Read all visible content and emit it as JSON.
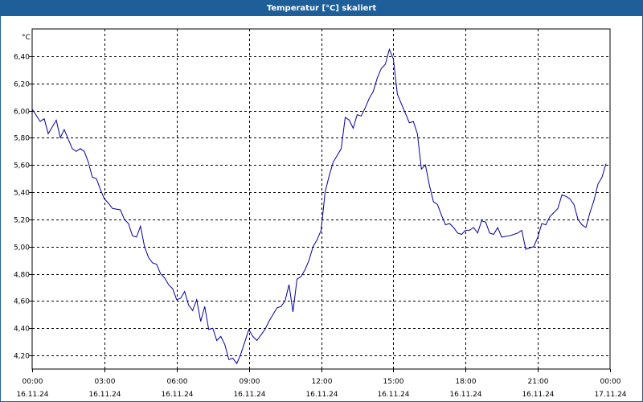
{
  "window": {
    "title": "Temperatur [°C] skaliert"
  },
  "colors": {
    "titlebar": "#1f5f99",
    "series": "#0000a0",
    "grid": "#000000"
  },
  "chart_data": {
    "type": "line",
    "title": "Temperatur [°C] skaliert",
    "yunit": "°C",
    "ylim": [
      4.1,
      6.6
    ],
    "yticks": [
      4.2,
      4.4,
      4.6,
      4.8,
      5.0,
      5.2,
      5.4,
      5.6,
      5.8,
      6.0,
      6.2,
      6.4
    ],
    "ytick_labels": [
      "4,20",
      "4,40",
      "4,60",
      "4,80",
      "5,00",
      "5,20",
      "5,40",
      "5,60",
      "5,80",
      "6,00",
      "6,20",
      "6,40"
    ],
    "xlim": [
      "16.11.24 00:00",
      "17.11.24 00:00"
    ],
    "xticks": [
      {
        "time": "00:00",
        "date": "16.11.24"
      },
      {
        "time": "03:00",
        "date": "16.11.24"
      },
      {
        "time": "06:00",
        "date": "16.11.24"
      },
      {
        "time": "09:00",
        "date": "16.11.24"
      },
      {
        "time": "12:00",
        "date": "16.11.24"
      },
      {
        "time": "15:00",
        "date": "16.11.24"
      },
      {
        "time": "18:00",
        "date": "16.11.24"
      },
      {
        "time": "21:00",
        "date": "16.11.24"
      },
      {
        "time": "00:00",
        "date": "17.11.24"
      }
    ],
    "grid": true,
    "series": [
      {
        "points": [
          [
            "16.11.24 00:00",
            6.01
          ],
          [
            "16.11.24 00:20",
            5.92
          ],
          [
            "16.11.24 00:30",
            5.94
          ],
          [
            "16.11.24 00:40",
            5.83
          ],
          [
            "16.11.24 01:00",
            5.93
          ],
          [
            "16.11.24 01:10",
            5.8
          ],
          [
            "16.11.24 01:20",
            5.86
          ],
          [
            "16.11.24 01:40",
            5.72
          ],
          [
            "16.11.24 01:50",
            5.7
          ],
          [
            "16.11.24 02:00",
            5.72
          ],
          [
            "16.11.24 02:10",
            5.7
          ],
          [
            "16.11.24 02:20",
            5.62
          ],
          [
            "16.11.24 02:30",
            5.51
          ],
          [
            "16.11.24 02:40",
            5.5
          ],
          [
            "16.11.24 02:50",
            5.42
          ],
          [
            "16.11.24 03:00",
            5.35
          ],
          [
            "16.11.24 03:10",
            5.32
          ],
          [
            "16.11.24 03:20",
            5.28
          ],
          [
            "16.11.24 03:40",
            5.27
          ],
          [
            "16.11.24 03:50",
            5.2
          ],
          [
            "16.11.24 04:00",
            5.17
          ],
          [
            "16.11.24 04:10",
            5.08
          ],
          [
            "16.11.24 04:20",
            5.07
          ],
          [
            "16.11.24 04:30",
            5.15
          ],
          [
            "16.11.24 04:40",
            5.0
          ],
          [
            "16.11.24 04:50",
            4.92
          ],
          [
            "16.11.24 05:00",
            4.88
          ],
          [
            "16.11.24 05:10",
            4.87
          ],
          [
            "16.11.24 05:20",
            4.8
          ],
          [
            "16.11.24 05:30",
            4.77
          ],
          [
            "16.11.24 05:40",
            4.72
          ],
          [
            "16.11.24 05:50",
            4.69
          ],
          [
            "16.11.24 06:00",
            4.61
          ],
          [
            "16.11.24 06:10",
            4.62
          ],
          [
            "16.11.24 06:20",
            4.67
          ],
          [
            "16.11.24 06:30",
            4.57
          ],
          [
            "16.11.24 06:40",
            4.53
          ],
          [
            "16.11.24 06:50",
            4.61
          ],
          [
            "16.11.24 07:00",
            4.45
          ],
          [
            "16.11.24 07:10",
            4.56
          ],
          [
            "16.11.24 07:20",
            4.39
          ],
          [
            "16.11.24 07:30",
            4.4
          ],
          [
            "16.11.24 07:40",
            4.31
          ],
          [
            "16.11.24 07:50",
            4.34
          ],
          [
            "16.11.24 08:00",
            4.28
          ],
          [
            "16.11.24 08:10",
            4.17
          ],
          [
            "16.11.24 08:20",
            4.18
          ],
          [
            "16.11.24 08:30",
            4.14
          ],
          [
            "16.11.24 08:40",
            4.21
          ],
          [
            "16.11.24 08:50",
            4.3
          ],
          [
            "16.11.24 09:00",
            4.39
          ],
          [
            "16.11.24 09:10",
            4.34
          ],
          [
            "16.11.24 09:20",
            4.31
          ],
          [
            "16.11.24 09:30",
            4.35
          ],
          [
            "16.11.24 09:40",
            4.39
          ],
          [
            "16.11.24 09:50",
            4.45
          ],
          [
            "16.11.24 10:00",
            4.5
          ],
          [
            "16.11.24 10:10",
            4.55
          ],
          [
            "16.11.24 10:20",
            4.56
          ],
          [
            "16.11.24 10:30",
            4.6
          ],
          [
            "16.11.24 10:40",
            4.72
          ],
          [
            "16.11.24 10:50",
            4.52
          ],
          [
            "16.11.24 11:00",
            4.76
          ],
          [
            "16.11.24 11:10",
            4.78
          ],
          [
            "16.11.24 11:20",
            4.83
          ],
          [
            "16.11.24 11:30",
            4.9
          ],
          [
            "16.11.24 11:40",
            5.0
          ],
          [
            "16.11.24 11:50",
            5.05
          ],
          [
            "16.11.24 12:00",
            5.12
          ],
          [
            "16.11.24 12:10",
            5.4
          ],
          [
            "16.11.24 12:20",
            5.52
          ],
          [
            "16.11.24 12:30",
            5.62
          ],
          [
            "16.11.24 12:40",
            5.67
          ],
          [
            "16.11.24 12:50",
            5.72
          ],
          [
            "16.11.24 13:00",
            5.95
          ],
          [
            "16.11.24 13:10",
            5.93
          ],
          [
            "16.11.24 13:20",
            5.87
          ],
          [
            "16.11.24 13:30",
            5.97
          ],
          [
            "16.11.24 13:40",
            5.96
          ],
          [
            "16.11.24 13:50",
            6.02
          ],
          [
            "16.11.24 14:00",
            6.09
          ],
          [
            "16.11.24 14:10",
            6.14
          ],
          [
            "16.11.24 14:20",
            6.24
          ],
          [
            "16.11.24 14:30",
            6.31
          ],
          [
            "16.11.24 14:40",
            6.34
          ],
          [
            "16.11.24 14:50",
            6.45
          ],
          [
            "16.11.24 15:00",
            6.38
          ],
          [
            "16.11.24 15:10",
            6.12
          ],
          [
            "16.11.24 15:20",
            6.05
          ],
          [
            "16.11.24 15:30",
            5.98
          ],
          [
            "16.11.24 15:40",
            5.91
          ],
          [
            "16.11.24 15:50",
            5.92
          ],
          [
            "16.11.24 16:00",
            5.83
          ],
          [
            "16.11.24 16:10",
            5.57
          ],
          [
            "16.11.24 16:20",
            5.6
          ],
          [
            "16.11.24 16:30",
            5.45
          ],
          [
            "16.11.24 16:40",
            5.33
          ],
          [
            "16.11.24 16:50",
            5.31
          ],
          [
            "16.11.24 17:00",
            5.23
          ],
          [
            "16.11.24 17:10",
            5.16
          ],
          [
            "16.11.24 17:20",
            5.17
          ],
          [
            "16.11.24 17:30",
            5.14
          ],
          [
            "16.11.24 17:40",
            5.1
          ],
          [
            "16.11.24 17:50",
            5.09
          ],
          [
            "16.11.24 18:00",
            5.12
          ],
          [
            "16.11.24 18:10",
            5.12
          ],
          [
            "16.11.24 18:20",
            5.14
          ],
          [
            "16.11.24 18:30",
            5.1
          ],
          [
            "16.11.24 18:40",
            5.19
          ],
          [
            "16.11.24 18:50",
            5.18
          ],
          [
            "16.11.24 19:00",
            5.1
          ],
          [
            "16.11.24 19:10",
            5.09
          ],
          [
            "16.11.24 19:20",
            5.14
          ],
          [
            "16.11.24 19:30",
            5.07
          ],
          [
            "16.11.24 19:50",
            5.08
          ],
          [
            "16.11.24 20:10",
            5.1
          ],
          [
            "16.11.24 20:20",
            5.12
          ],
          [
            "16.11.24 20:30",
            4.98
          ],
          [
            "16.11.24 20:40",
            4.99
          ],
          [
            "16.11.24 20:50",
            5.0
          ],
          [
            "16.11.24 21:00",
            5.07
          ],
          [
            "16.11.24 21:10",
            5.17
          ],
          [
            "16.11.24 21:20",
            5.16
          ],
          [
            "16.11.24 21:30",
            5.22
          ],
          [
            "16.11.24 21:40",
            5.25
          ],
          [
            "16.11.24 21:50",
            5.28
          ],
          [
            "16.11.24 22:00",
            5.38
          ],
          [
            "16.11.24 22:10",
            5.37
          ],
          [
            "16.11.24 22:20",
            5.35
          ],
          [
            "16.11.24 22:30",
            5.31
          ],
          [
            "16.11.24 22:40",
            5.2
          ],
          [
            "16.11.24 22:50",
            5.16
          ],
          [
            "16.11.24 23:00",
            5.14
          ],
          [
            "16.11.24 23:10",
            5.25
          ],
          [
            "16.11.24 23:20",
            5.34
          ],
          [
            "16.11.24 23:30",
            5.46
          ],
          [
            "16.11.24 23:40",
            5.51
          ],
          [
            "16.11.24 23:50",
            5.61
          ]
        ]
      }
    ]
  }
}
